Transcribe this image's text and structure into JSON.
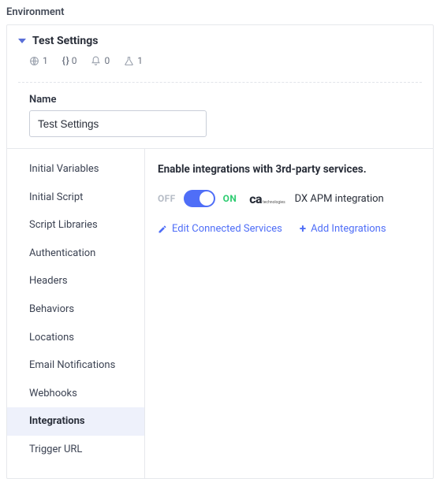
{
  "section_label": "Environment",
  "panel": {
    "title": "Test Settings",
    "stats": {
      "globe": "1",
      "braces": "0",
      "bell": "0",
      "flask": "1"
    }
  },
  "name_field": {
    "label": "Name",
    "value": "Test Settings"
  },
  "sidebar": {
    "items": [
      {
        "label": "Initial Variables",
        "active": false
      },
      {
        "label": "Initial Script",
        "active": false
      },
      {
        "label": "Script Libraries",
        "active": false
      },
      {
        "label": "Authentication",
        "active": false
      },
      {
        "label": "Headers",
        "active": false
      },
      {
        "label": "Behaviors",
        "active": false
      },
      {
        "label": "Locations",
        "active": false
      },
      {
        "label": "Email Notifications",
        "active": false
      },
      {
        "label": "Webhooks",
        "active": false
      },
      {
        "label": "Integrations",
        "active": true
      },
      {
        "label": "Trigger URL",
        "active": false
      }
    ]
  },
  "content": {
    "heading": "Enable integrations with 3rd-party services.",
    "toggle": {
      "off": "OFF",
      "on": "ON",
      "state": "on"
    },
    "integration": {
      "logo_main": "ca",
      "logo_sub": "technologies",
      "name": "DX APM integration"
    },
    "actions": {
      "edit": "Edit Connected Services",
      "add": "Add Integrations"
    }
  }
}
